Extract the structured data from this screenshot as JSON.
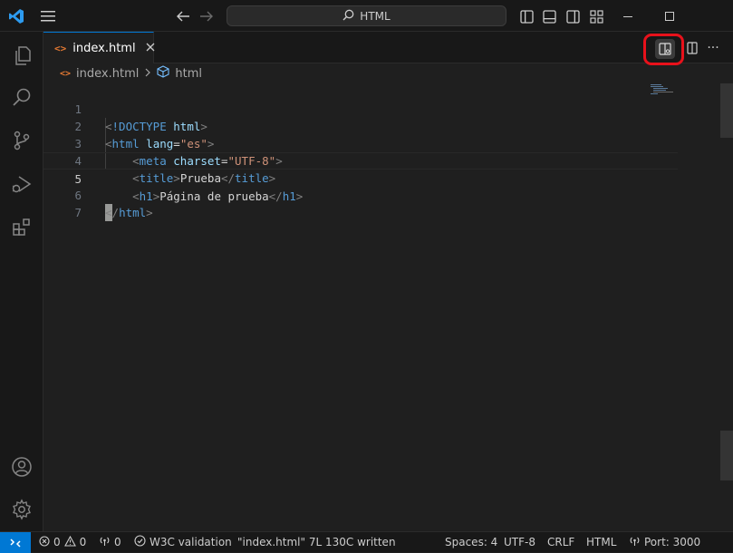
{
  "titlebar": {
    "search_text": "HTML",
    "icons": [
      "vscode-logo-icon",
      "menu-icon",
      "back-arrow-icon",
      "forward-arrow-icon",
      "search-icon",
      "toggle-primary-sidebar-icon",
      "toggle-panel-icon",
      "toggle-secondary-sidebar-icon",
      "customize-layout-icon",
      "minimize-icon",
      "maximize-icon"
    ]
  },
  "activitybar": {
    "items": [
      "explorer-icon",
      "search-icon",
      "source-control-icon",
      "run-debug-icon",
      "extensions-icon"
    ],
    "bottom": [
      "accounts-icon",
      "manage-gear-icon"
    ]
  },
  "tab": {
    "label": "index.html",
    "file_icon": "html-file-icon"
  },
  "breadcrumb": {
    "file": "index.html",
    "element": "html"
  },
  "editor": {
    "line_numbers": [
      "1",
      "2",
      "3",
      "4",
      "5",
      "6",
      "7"
    ],
    "current_line": "5",
    "lines": {
      "l1": {
        "open": "<",
        "doctype": "!DOCTYPE",
        "name": "html",
        "close": ">"
      },
      "l2": {
        "open": "<",
        "tag": "html",
        "attr": "lang",
        "eq": "=",
        "val": "\"es\"",
        "close": ">"
      },
      "l3": {
        "open": "<",
        "tag": "meta",
        "attr": "charset",
        "eq": "=",
        "val": "\"UTF-8\"",
        "close": ">"
      },
      "l4": {
        "open": "<",
        "tag": "title",
        "close": ">",
        "text": "Prueba",
        "end_open": "</",
        "end_tag": "title",
        "end_close": ">"
      },
      "l5": {
        "open": "<",
        "tag": "h1",
        "close": ">",
        "text": "Página de prueba",
        "end_open": "</",
        "end_tag": "h1",
        "end_close": ">"
      },
      "l6": {
        "end_open": "</",
        "end_tag": "html",
        "end_close": ">"
      }
    },
    "more_actions": "···"
  },
  "statusbar": {
    "errors": "0",
    "warnings": "0",
    "ports": "0",
    "w3c": "W3C validation",
    "message": "\"index.html\" 7L 130C written",
    "spaces": "Spaces: 4",
    "encoding": "UTF-8",
    "eol": "CRLF",
    "language": "HTML",
    "port": "Port: 3000"
  },
  "colors": {
    "accent": "#0078d4",
    "highlight_ring": "#e8111b",
    "tag": "#569cd6",
    "attr": "#9cdcfe",
    "string": "#ce9178"
  }
}
